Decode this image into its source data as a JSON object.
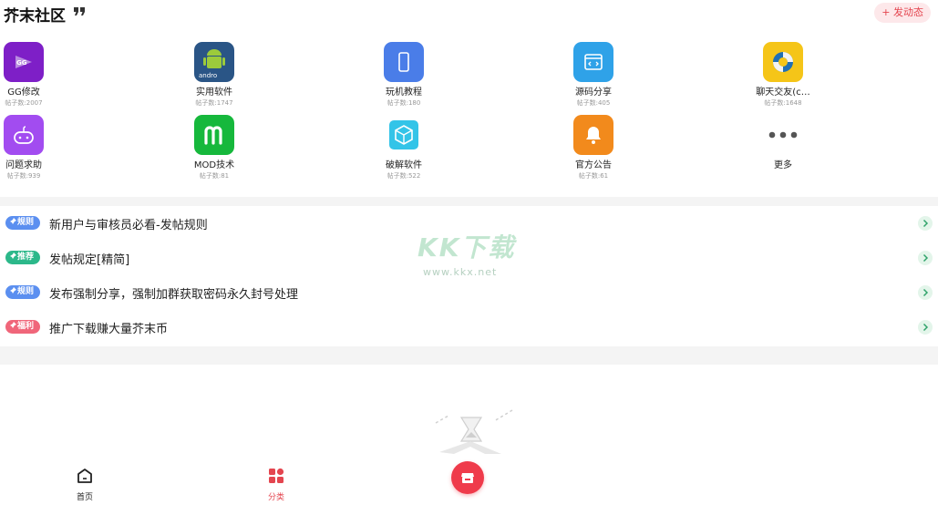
{
  "header": {
    "title": "芥末社区",
    "post_button": "+ 发动态"
  },
  "categories": [
    {
      "name": "GG修改",
      "count": "帖子数:2007",
      "icon": "gg-modifier-icon",
      "color": "#7e1fc7"
    },
    {
      "name": "实用软件",
      "count": "帖子数:1747",
      "icon": "android-icon",
      "color": "#2a5586"
    },
    {
      "name": "玩机教程",
      "count": "帖子数:180",
      "icon": "phone-icon",
      "color": "#4a7de8"
    },
    {
      "name": "源码分享",
      "count": "帖子数:405",
      "icon": "code-icon",
      "color": "#2fa2e8"
    },
    {
      "name": "聊天交友(c…",
      "count": "帖子数:1648",
      "icon": "chat-ring-icon",
      "color": "#f5c518"
    },
    {
      "name": "问题求助",
      "count": "帖子数:939",
      "icon": "gamepad-icon",
      "color": "#a24cf0"
    },
    {
      "name": "MOD技术",
      "count": "帖子数:81",
      "icon": "mod-icon",
      "color": "#16b83c"
    },
    {
      "name": "破解软件",
      "count": "帖子数:522",
      "icon": "cube-icon",
      "color": "#33c4e8"
    },
    {
      "name": "官方公告",
      "count": "帖子数:61",
      "icon": "bell-icon",
      "color": "#f28a1c"
    },
    {
      "name": "更多",
      "count": "",
      "icon": "more-dots-icon",
      "color": "#555555"
    }
  ],
  "notices": [
    {
      "badge": "规则",
      "badge_color": "#5b8ff0",
      "text": "新用户与审核员必看-发帖规则"
    },
    {
      "badge": "推荐",
      "badge_color": "#2cb88a",
      "text": "发帖规定[精简]"
    },
    {
      "badge": "规则",
      "badge_color": "#5b8ff0",
      "text": "发布强制分享，强制加群获取密码永久封号处理"
    },
    {
      "badge": "福利",
      "badge_color": "#f0667a",
      "text": "推广下载赚大量芥末币"
    }
  ],
  "watermark": {
    "big": "KK下载",
    "small": "www.kkx.net"
  },
  "tabbar": {
    "home": "首页",
    "category": "分类",
    "active_color": "#e4454f"
  }
}
